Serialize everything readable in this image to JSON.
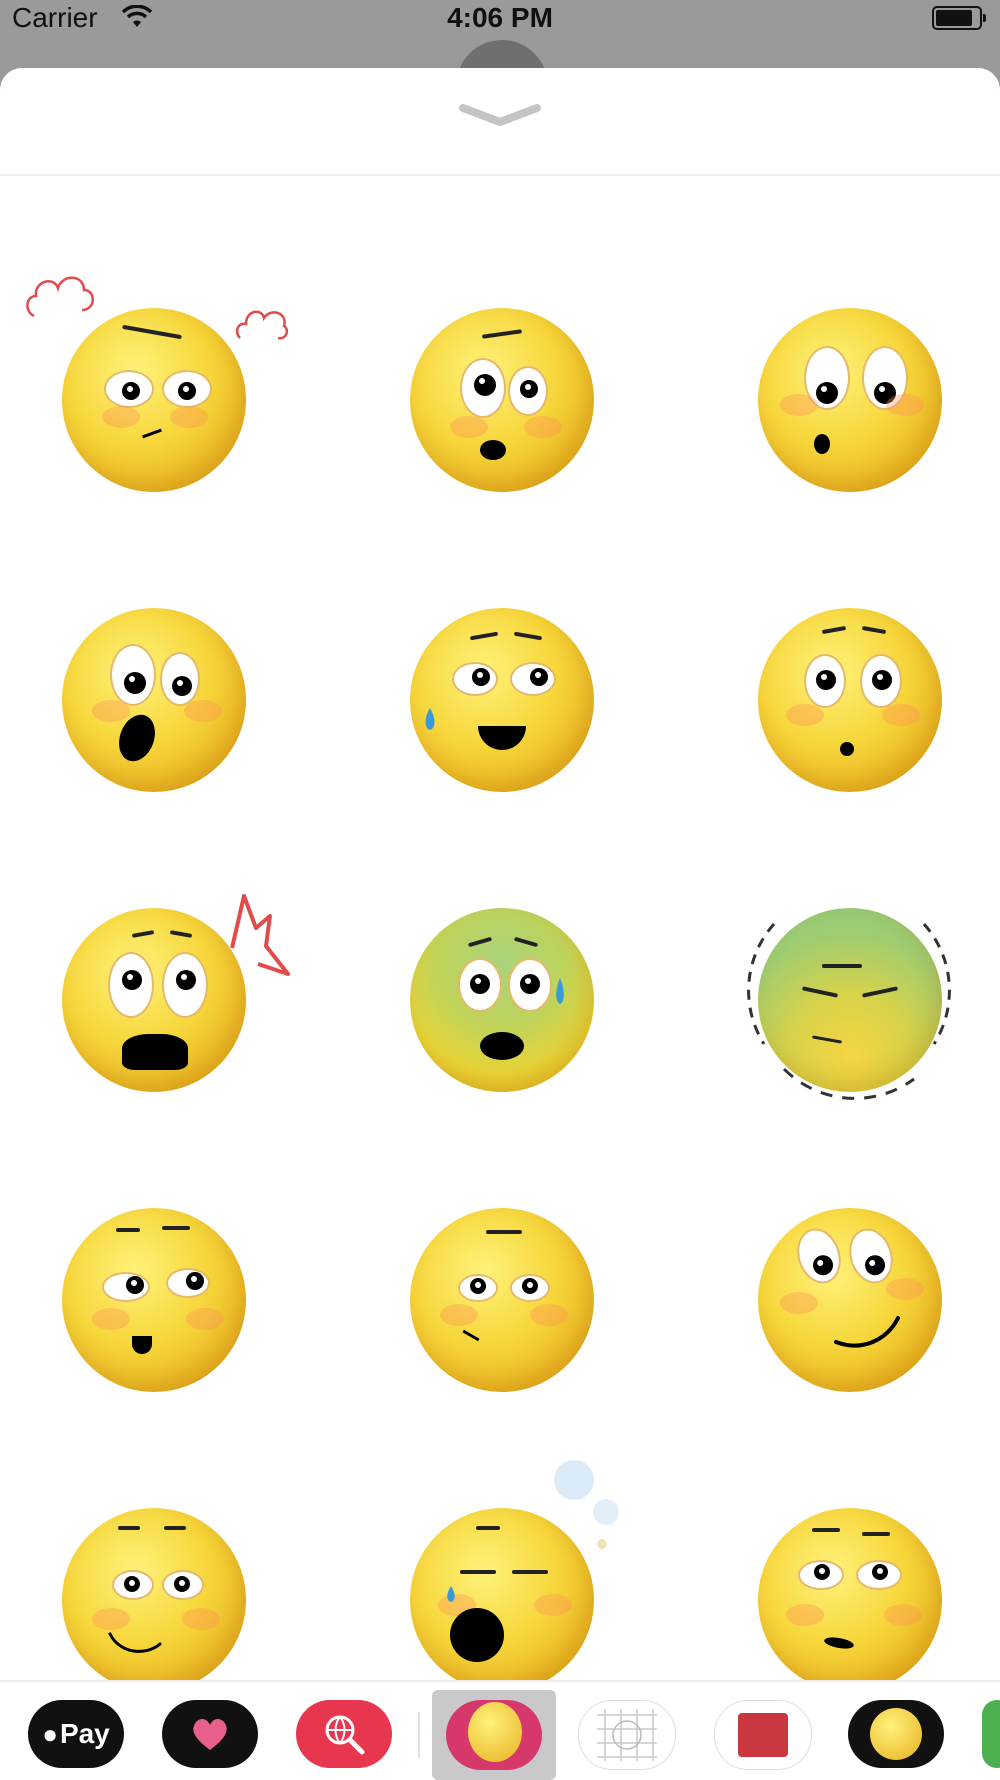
{
  "status_bar": {
    "carrier": "Carrier",
    "time": "4:06 PM"
  },
  "sheet": {
    "grabber_icon": "chevron-down"
  },
  "stickers": [
    {
      "name": "angry-steam-emoji"
    },
    {
      "name": "worried-surprised-emoji"
    },
    {
      "name": "curious-oh-emoji"
    },
    {
      "name": "shocked-open-mouth-emoji"
    },
    {
      "name": "nervous-sweat-grin-emoji"
    },
    {
      "name": "small-surprised-emoji"
    },
    {
      "name": "startled-shout-emoji"
    },
    {
      "name": "scared-sweat-emoji"
    },
    {
      "name": "nauseous-shaking-emoji"
    },
    {
      "name": "unimpressed-side-eye-emoji"
    },
    {
      "name": "smirking-emoji"
    },
    {
      "name": "playful-smile-emoji"
    },
    {
      "name": "sleepy-smile-emoji"
    },
    {
      "name": "yawning-tired-emoji"
    },
    {
      "name": "doubtful-emoji"
    }
  ],
  "tray": {
    "apple_pay_label": "Pay",
    "items": [
      "apple-pay",
      "heart-sticker-app",
      "search-images-app",
      "emoji-sticker-app",
      "grid-app",
      "yeah-sticker-app",
      "emoji-dark-app",
      "more-app"
    ],
    "colors": {
      "apple_pay": "#111111",
      "heart_app": "#111111",
      "search_app": "#e8364e",
      "selected_app": "#d6386b"
    }
  }
}
